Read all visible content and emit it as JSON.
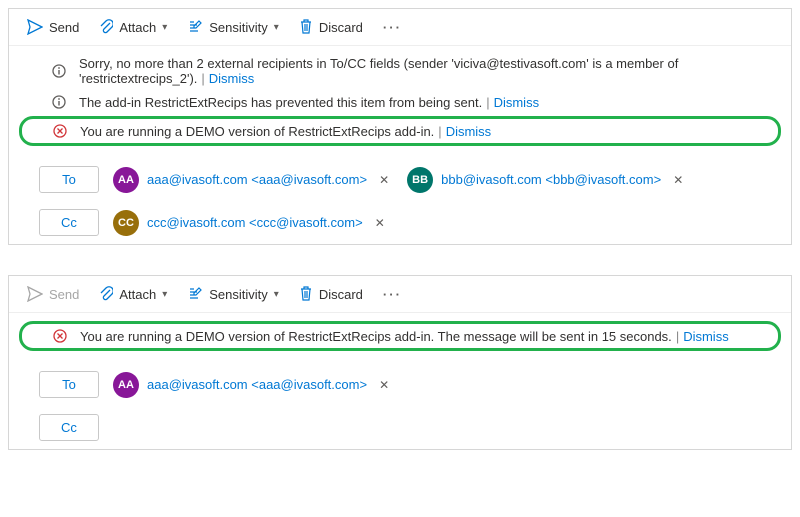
{
  "colors": {
    "link": "#0078d4",
    "highlight": "#22b14c"
  },
  "toolbar": {
    "send": "Send",
    "attach": "Attach",
    "sensitivity": "Sensitivity",
    "discard": "Discard"
  },
  "pane1": {
    "notices": [
      {
        "kind": "info",
        "text": "Sorry, no more than 2 external recipients in To/CC fields (sender 'viciva@testivasoft.com' is a member of 'restrictextrecips_2').",
        "dismiss": "Dismiss"
      },
      {
        "kind": "info",
        "text": "The add-in RestrictExtRecips has prevented this item from being sent.",
        "dismiss": "Dismiss"
      },
      {
        "kind": "error",
        "text": "You are running a DEMO version of RestrictExtRecips add-in.",
        "dismiss": "Dismiss",
        "highlight": true
      }
    ],
    "fields": {
      "to": {
        "label": "To",
        "recipients": [
          {
            "initials": "AA",
            "color": "av-purple",
            "text": "aaa@ivasoft.com <aaa@ivasoft.com>"
          },
          {
            "initials": "BB",
            "color": "av-teal",
            "text": "bbb@ivasoft.com <bbb@ivasoft.com>"
          }
        ]
      },
      "cc": {
        "label": "Cc",
        "recipients": [
          {
            "initials": "CC",
            "color": "av-olive",
            "text": "ccc@ivasoft.com <ccc@ivasoft.com>"
          }
        ]
      }
    }
  },
  "pane2": {
    "send_disabled": true,
    "notices": [
      {
        "kind": "error",
        "text": "You are running a DEMO version of RestrictExtRecips add-in. The message will be sent in 15 seconds.",
        "dismiss": "Dismiss",
        "highlight": true
      }
    ],
    "fields": {
      "to": {
        "label": "To",
        "recipients": [
          {
            "initials": "AA",
            "color": "av-purple",
            "text": "aaa@ivasoft.com <aaa@ivasoft.com>"
          }
        ]
      },
      "cc": {
        "label": "Cc",
        "recipients": []
      }
    }
  }
}
